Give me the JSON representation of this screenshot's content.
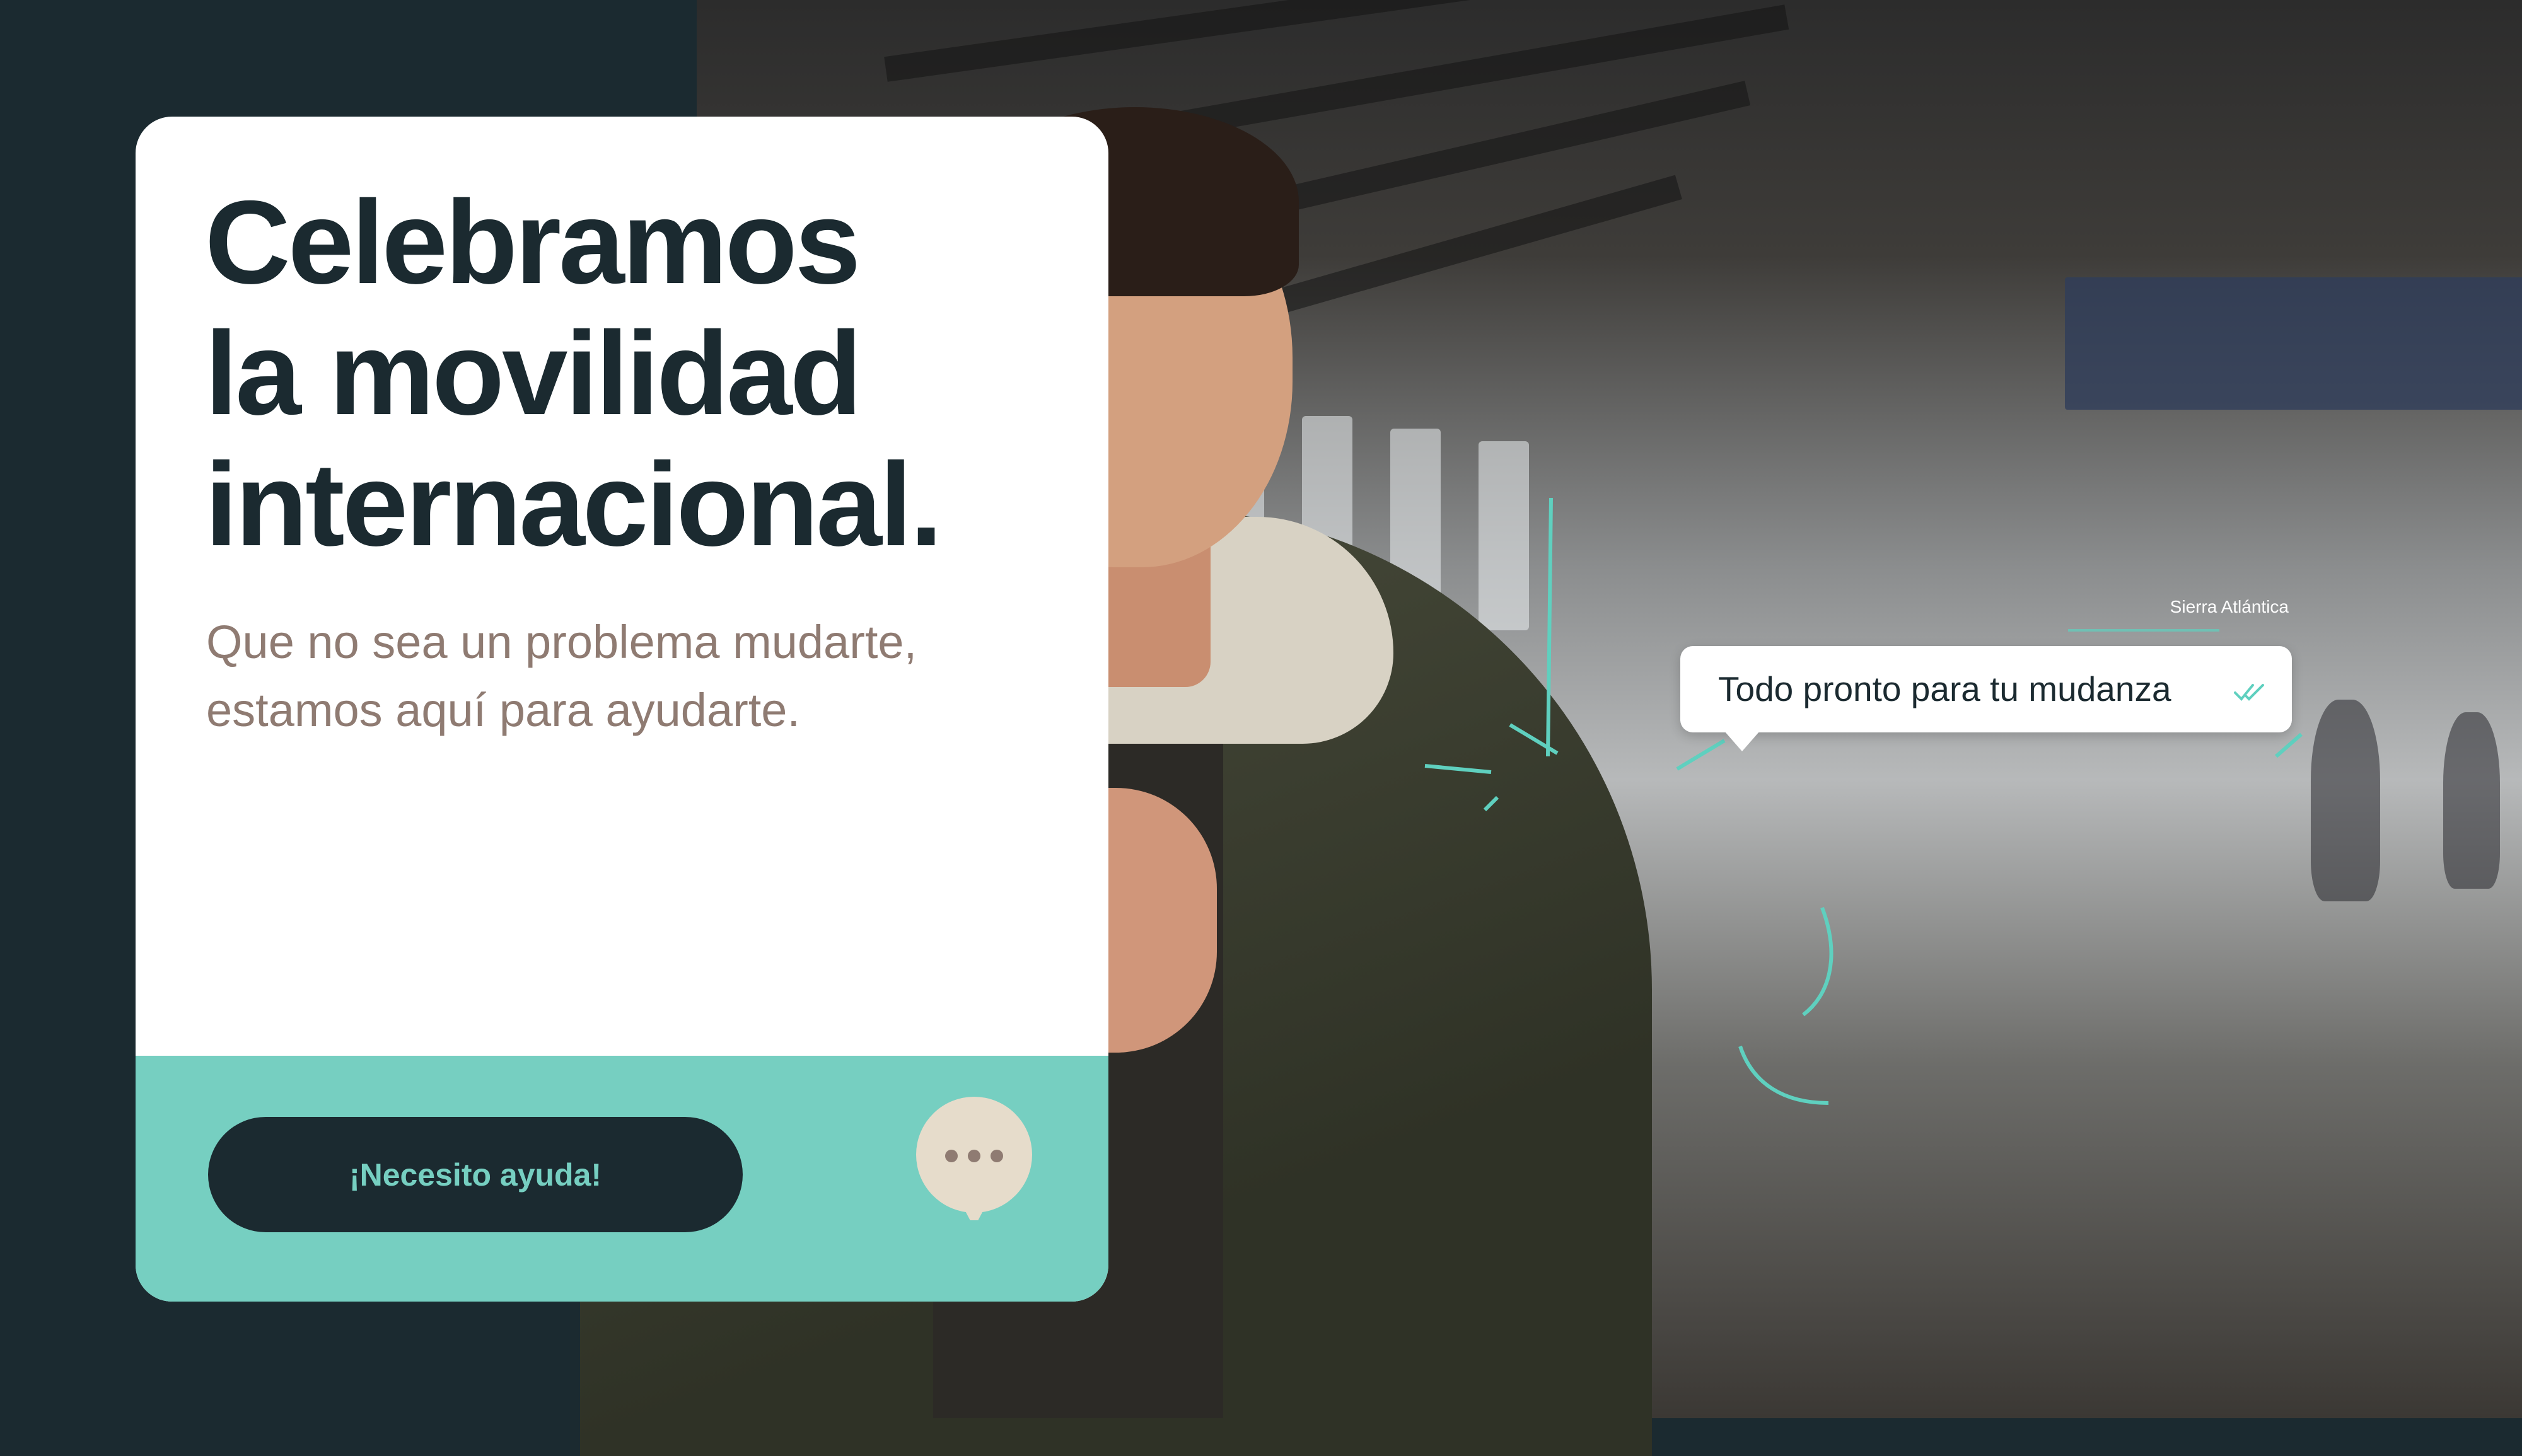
{
  "card": {
    "headline": [
      "Celebramos",
      "la movilidad",
      "internacional."
    ],
    "subtitle": [
      "Que no sea un problema mudarte,",
      "estamos aquí para ayudarte."
    ],
    "cta_label": "¡Necesito ayuda!"
  },
  "chat": {
    "sender": "Sierra Atlántica",
    "message": "Todo pronto para tu mudanza"
  },
  "colors": {
    "dark": "#1b2a30",
    "teal": "#76cfc1",
    "subtitle": "#8f7b72",
    "chat_icon": "#e6dccb"
  },
  "icons": [
    "chat-dots-icon",
    "double-check-icon"
  ]
}
